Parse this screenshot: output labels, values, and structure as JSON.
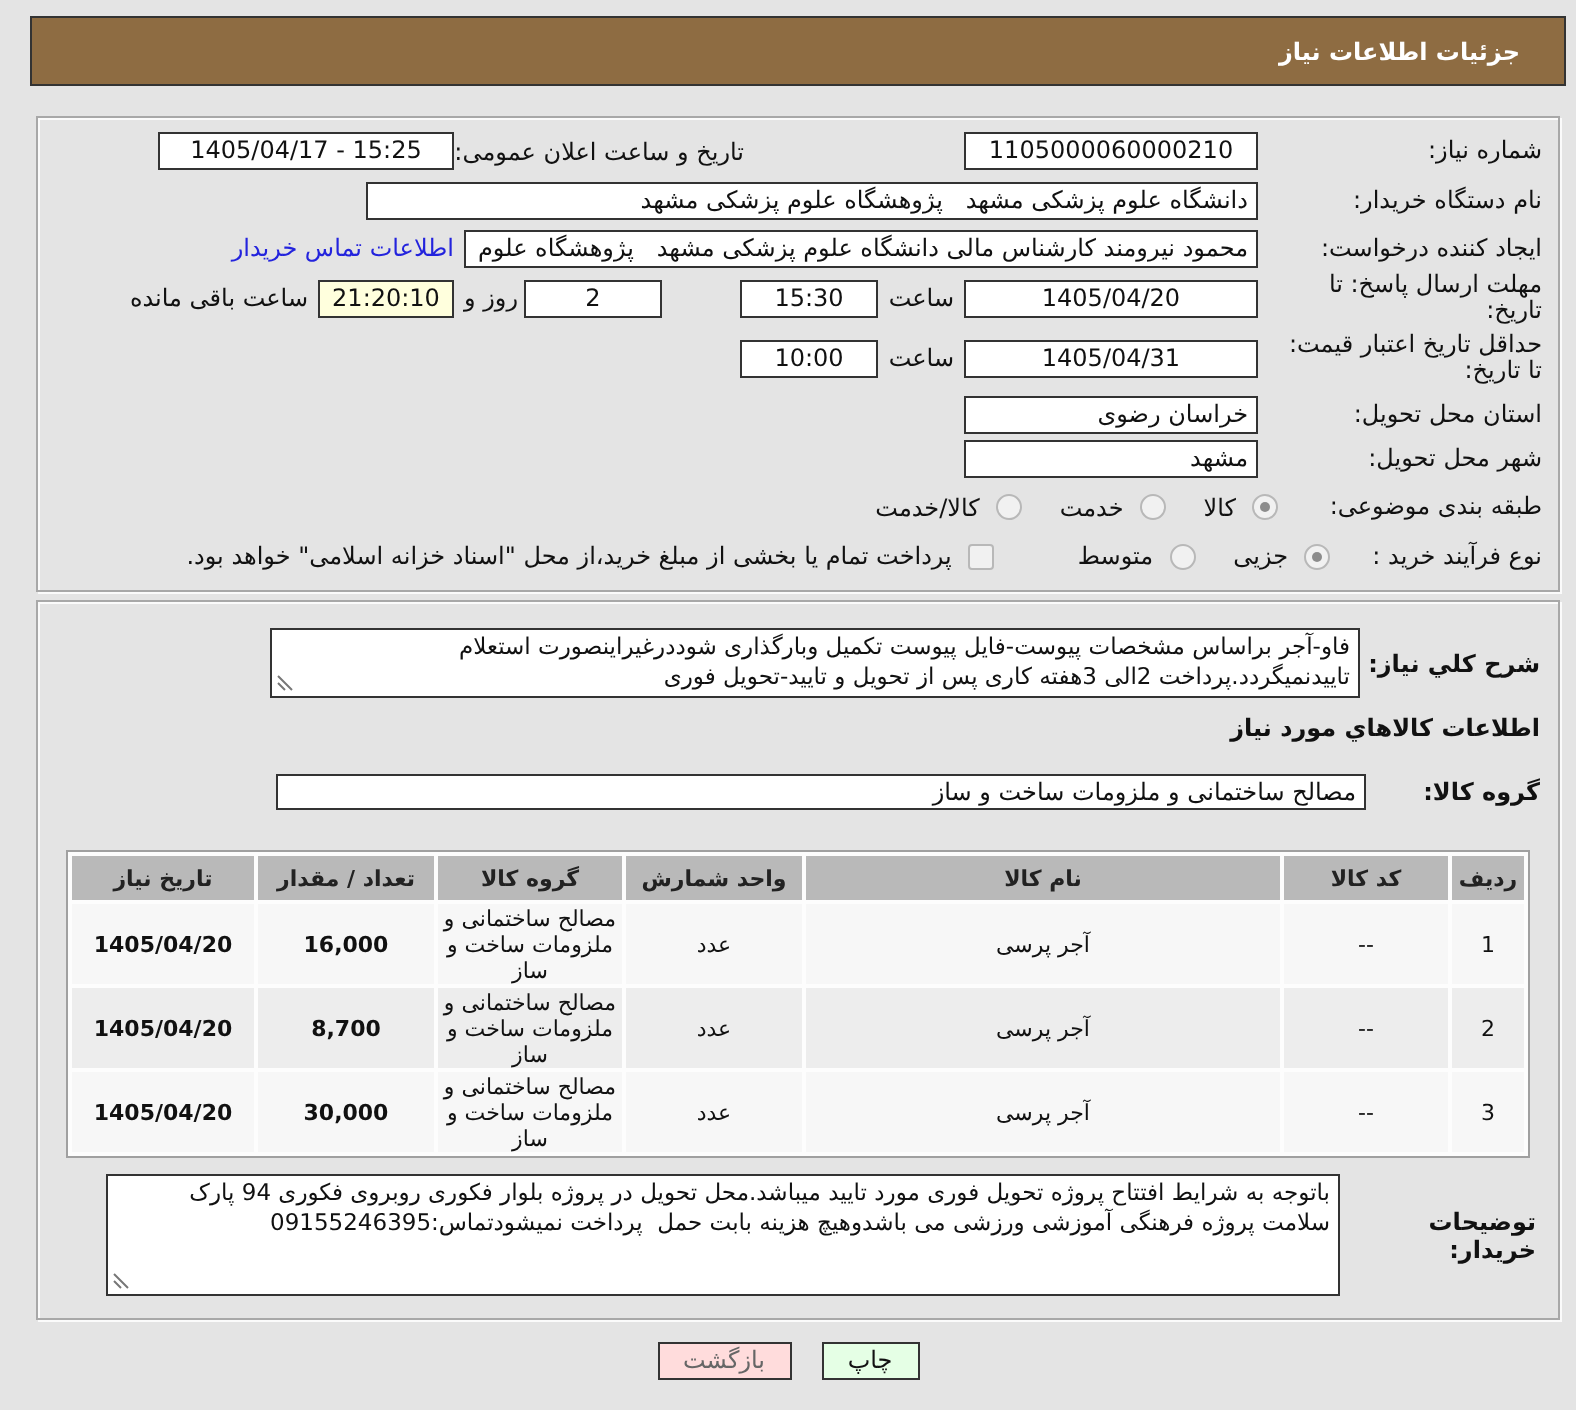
{
  "header": {
    "title": "جزئیات اطلاعات نیاز"
  },
  "need": {
    "number": {
      "label": "شماره نیاز:",
      "value": "1105000060000210"
    },
    "announce": {
      "label": "تاریخ و ساعت اعلان عمومی:",
      "value": "1405/04/17 - 15:25"
    },
    "buyer": {
      "label": "نام دستگاه خریدار:",
      "value": "دانشگاه علوم پزشکی مشهد   پژوهشگاه علوم پزشکی مشهد"
    },
    "requester": {
      "label": "ایجاد کننده درخواست:",
      "value": "محمود نیرومند کارشناس مالی دانشگاه علوم پزشکی مشهد   پژوهشگاه علوم",
      "contact_link": "اطلاعات تماس خریدار"
    },
    "deadline": {
      "label": "مهلت ارسال پاسخ: تا تاریخ:",
      "date": "1405/04/20",
      "time_label": "ساعت",
      "time": "15:30",
      "days": "2",
      "days_label": "روز و",
      "remaining": "21:20:10",
      "remaining_label": "ساعت باقی مانده"
    },
    "price_validity": {
      "label": "حداقل تاریخ اعتبار قیمت: تا تاریخ:",
      "date": "1405/04/31",
      "time_label": "ساعت",
      "time": "10:00"
    },
    "province": {
      "label": "استان محل تحویل:",
      "value": "خراسان رضوی"
    },
    "city": {
      "label": "شهر محل تحویل:",
      "value": "مشهد"
    },
    "classification": {
      "label": "طبقه بندی موضوعی:",
      "options": [
        {
          "label": "کالا",
          "selected": true
        },
        {
          "label": "خدمت",
          "selected": false
        },
        {
          "label": "کالا/خدمت",
          "selected": false
        }
      ]
    },
    "purchase_type": {
      "label": "نوع فرآیند خرید :",
      "options": [
        {
          "label": "جزیی",
          "selected": true
        },
        {
          "label": "متوسط",
          "selected": false
        }
      ],
      "treasury": {
        "label": "پرداخت تمام یا بخشی از مبلغ خرید،از محل \"اسناد خزانه اسلامی\" خواهد بود.",
        "checked": false
      }
    }
  },
  "description": {
    "label": "شرح کلي نیاز:",
    "text": "فاو-آجر براساس مشخصات پیوست-فایل پیوست تکمیل وبارگذاری شوددرغیراینصورت استعلام تاییدنمیگردد.پرداخت 2الی 3هفته کاری پس از تحویل و تایید-تحویل فوری"
  },
  "goods": {
    "title": "اطلاعات کالاهاي مورد نیاز",
    "group": {
      "label": "گروه کالا:",
      "value": "مصالح ساختمانی و ملزومات ساخت و ساز"
    },
    "table": {
      "columns": [
        "ردیف",
        "کد کالا",
        "نام کالا",
        "واحد شمارش",
        "گروه کالا",
        "تعداد / مقدار",
        "تاریخ نیاز"
      ],
      "rows": [
        {
          "cells": [
            "1",
            "--",
            "آجر پرسی",
            "عدد",
            "مصالح ساختمانی و ملزومات ساخت و ساز",
            "16,000",
            "1405/04/20"
          ]
        },
        {
          "cells": [
            "2",
            "--",
            "آجر پرسی",
            "عدد",
            "مصالح ساختمانی و ملزومات ساخت و ساز",
            "8,700",
            "1405/04/20"
          ]
        },
        {
          "cells": [
            "3",
            "--",
            "آجر پرسی",
            "عدد",
            "مصالح ساختمانی و ملزومات ساخت و ساز",
            "30,000",
            "1405/04/20"
          ]
        }
      ]
    }
  },
  "buyer_notes": {
    "label": "توضیحات خریدار:",
    "text": "باتوجه به شرایط افتتاح پروژه تحویل فوری مورد تایید میباشد.محل تحویل در پروژه بلوار فکوری روبروی فکوری 94 پارک سلامت پروژه فرهنگی آموزشی ورزشی می باشدوهیچ هزینه بابت حمل  پرداخت نمیشودتماس:09155246395"
  },
  "buttons": [
    {
      "label": "چاپ",
      "kind": "print"
    },
    {
      "label": "بازگشت",
      "kind": "back"
    }
  ]
}
